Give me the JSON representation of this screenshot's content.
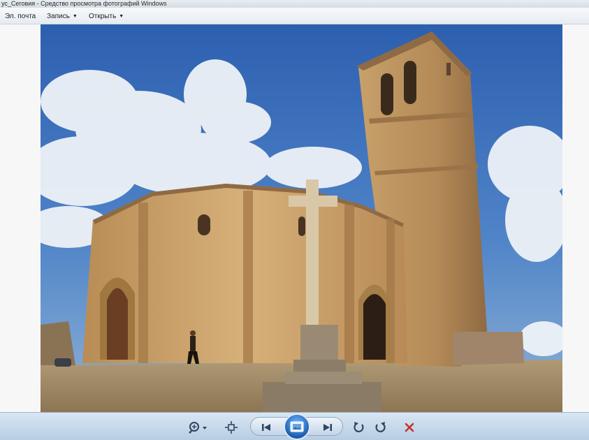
{
  "window": {
    "title": "ус_Сеговия - Средство просмотра фотографий Windows"
  },
  "menu": {
    "items": [
      {
        "label": "Эл. почта",
        "has_dropdown": false
      },
      {
        "label": "Запись",
        "has_dropdown": true
      },
      {
        "label": "Открыть",
        "has_dropdown": true
      }
    ],
    "dropdown_glyph": "▼"
  },
  "photo": {
    "alt": "Church photograph"
  },
  "controls": {
    "icons": [
      "zoom-icon",
      "actual-size-icon",
      "previous-icon",
      "slideshow-icon",
      "next-icon",
      "rotate-counterclockwise-icon",
      "rotate-clockwise-icon",
      "delete-icon"
    ]
  },
  "colors": {
    "control_bar": "#c6d8ea",
    "delete": "#c8312b",
    "slideshow": "#1c5fb2"
  }
}
